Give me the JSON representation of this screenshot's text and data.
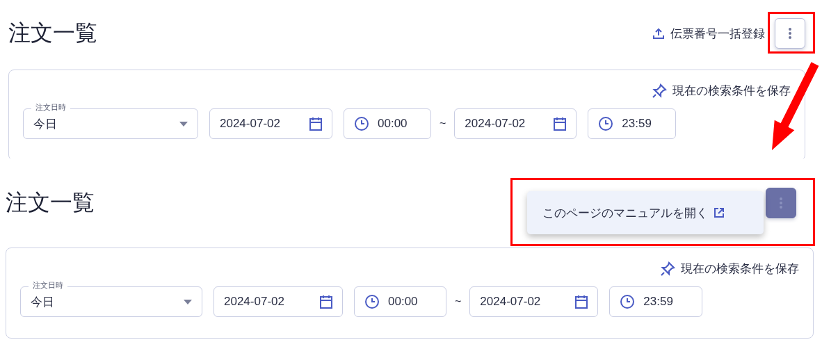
{
  "screens": [
    {
      "title": "注文一覧",
      "upload_link": "伝票番号一括登録",
      "more_button": {
        "selected": false
      },
      "save_link": "現在の検索条件を保存",
      "filter": {
        "label": "注文日時",
        "select_value": "今日",
        "start_date": "2024-07-02",
        "start_time": "00:00",
        "separator": "~",
        "end_date": "2024-07-02",
        "end_time": "23:59"
      }
    },
    {
      "title": "注文一覧",
      "more_button": {
        "selected": true
      },
      "menu": {
        "items": [
          {
            "label": "このページのマニュアルを開く"
          }
        ]
      },
      "save_link": "現在の検索条件を保存",
      "filter": {
        "label": "注文日時",
        "select_value": "今日",
        "start_date": "2024-07-02",
        "start_time": "00:00",
        "separator": "~",
        "end_date": "2024-07-02",
        "end_time": "23:59"
      }
    }
  ]
}
